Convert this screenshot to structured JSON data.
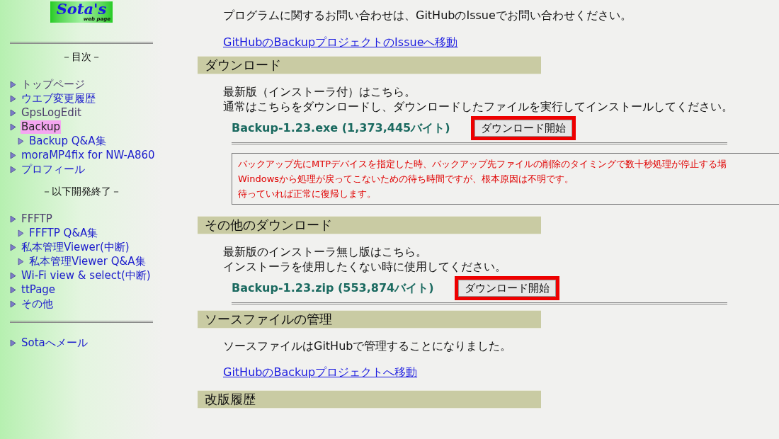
{
  "sidebar": {
    "logo": {
      "title": "Sota's",
      "subtitle": "web page"
    },
    "toc_title": "－目次－",
    "items": [
      {
        "label": "トップページ",
        "visited": true,
        "selected": false
      },
      {
        "label": "ウエブ変更履歴",
        "visited": false,
        "selected": false
      },
      {
        "label": "GpsLogEdit",
        "visited": true,
        "selected": false
      },
      {
        "label": "Backup",
        "visited": false,
        "selected": true,
        "children": [
          {
            "label": "Backup Q&A集",
            "visited": false,
            "selected": false
          }
        ]
      },
      {
        "label": "moraMP4fix for NW-A860",
        "visited": false,
        "selected": false
      },
      {
        "label": "プロフィール",
        "visited": false,
        "selected": false
      }
    ],
    "ended_title": "－以下開発終了－",
    "ended_items": [
      {
        "label": "FFFTP",
        "visited": true,
        "selected": false,
        "children": [
          {
            "label": "FFFTP Q&A集",
            "visited": false,
            "selected": false
          }
        ]
      },
      {
        "label": "私本管理Viewer(中断)",
        "visited": false,
        "selected": false,
        "children": [
          {
            "label": "私本管理Viewer Q&A集",
            "visited": false,
            "selected": false
          }
        ]
      },
      {
        "label": "Wi-Fi view & select(中断)",
        "visited": false,
        "selected": false
      },
      {
        "label": "ttPage",
        "visited": false,
        "selected": false
      },
      {
        "label": "その他",
        "visited": false,
        "selected": false
      }
    ],
    "contact_items": [
      {
        "label": "Sotaへメール",
        "visited": false,
        "selected": false
      }
    ]
  },
  "main": {
    "intro": {
      "text": "プログラムに関するお問い合わせは、GitHubのIssueでお問い合わせください。",
      "link": "GitHubのBackupプロジェクトのIssueへ移動"
    },
    "sections": [
      {
        "heading": "ダウンロード",
        "lines": [
          "最新版（インストーラ付）はこちら。",
          "通常はこちらをダウンロードし、ダウンロードしたファイルを実行してインストールしてください。"
        ],
        "file": {
          "name": "Backup-1.23.exe (1,373,445バイト)",
          "button": "ダウンロード開始",
          "highlighted": true
        },
        "notice": [
          "バックアップ先にMTPデバイスを指定した時、バックアップ先ファイルの削除のタイミングで数十秒処理が停止する場",
          "Windowsから処理が戻ってこないための待ち時間ですが、根本原因は不明です。",
          "待っていれば正常に復帰します。"
        ]
      },
      {
        "heading": "その他のダウンロード",
        "lines": [
          "最新版のインストーラ無し版はこちら。",
          "インストーラを使用したくない時に使用してください。"
        ],
        "file": {
          "name": "Backup-1.23.zip (553,874バイト)",
          "button": "ダウンロード開始",
          "highlighted": true
        }
      },
      {
        "heading": "ソースファイルの管理",
        "lines": [
          "ソースファイルはGitHubで管理することになりました。"
        ],
        "link": "GitHubのBackupプロジェクトへ移動"
      },
      {
        "heading": "改版履歴"
      }
    ]
  }
}
